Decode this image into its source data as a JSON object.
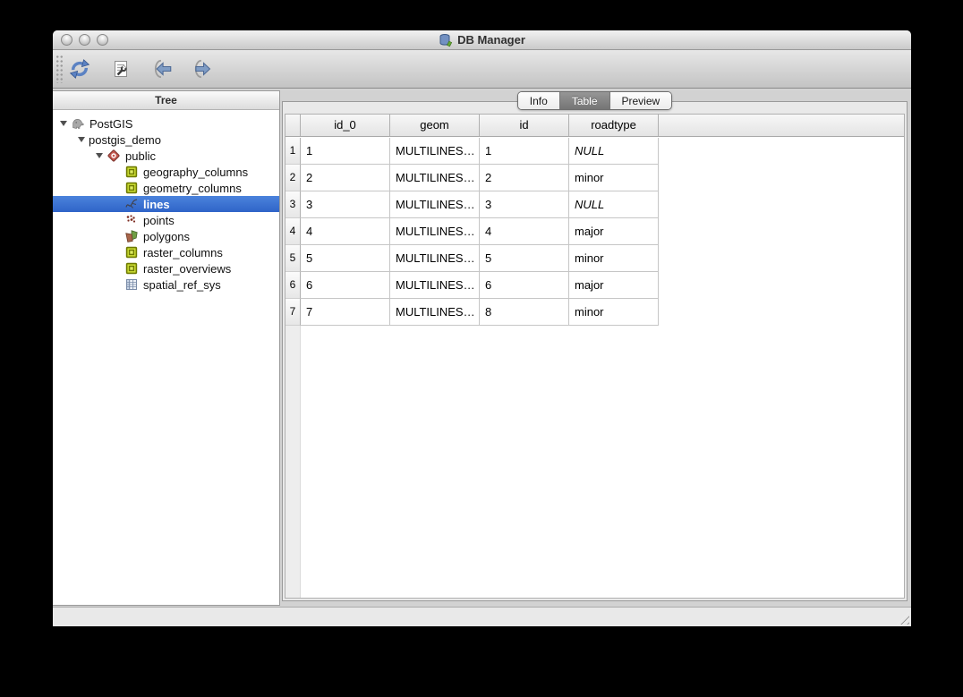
{
  "window": {
    "title": "DB Manager",
    "traffic_lights": [
      "close",
      "minimize",
      "zoom"
    ]
  },
  "toolbar": {
    "buttons": [
      {
        "name": "refresh",
        "icon": "refresh-icon"
      },
      {
        "name": "sql-window",
        "icon": "sql-window-icon"
      },
      {
        "name": "import-layer",
        "icon": "import-layer-icon"
      },
      {
        "name": "export-to-file",
        "icon": "export-to-file-icon"
      }
    ]
  },
  "sidebar": {
    "header": "Tree",
    "items": [
      {
        "label": "PostGIS",
        "level": 0,
        "icon": "postgis-icon",
        "expandable": true,
        "selected": false
      },
      {
        "label": "postgis_demo",
        "level": 1,
        "icon": null,
        "expandable": true,
        "selected": false
      },
      {
        "label": "public",
        "level": 2,
        "icon": "schema-icon",
        "expandable": true,
        "selected": false
      },
      {
        "label": "geography_columns",
        "level": 3,
        "icon": "attr-table-icon",
        "expandable": false,
        "selected": false
      },
      {
        "label": "geometry_columns",
        "level": 3,
        "icon": "attr-table-icon",
        "expandable": false,
        "selected": false
      },
      {
        "label": "lines",
        "level": 3,
        "icon": "line-layer-icon",
        "expandable": false,
        "selected": true
      },
      {
        "label": "points",
        "level": 3,
        "icon": "point-layer-icon",
        "expandable": false,
        "selected": false
      },
      {
        "label": "polygons",
        "level": 3,
        "icon": "polygon-layer-icon",
        "expandable": false,
        "selected": false
      },
      {
        "label": "raster_columns",
        "level": 3,
        "icon": "attr-table-icon",
        "expandable": false,
        "selected": false
      },
      {
        "label": "raster_overviews",
        "level": 3,
        "icon": "attr-table-icon",
        "expandable": false,
        "selected": false
      },
      {
        "label": "spatial_ref_sys",
        "level": 3,
        "icon": "table-icon",
        "expandable": false,
        "selected": false
      }
    ]
  },
  "tabs": [
    {
      "label": "Info",
      "active": false
    },
    {
      "label": "Table",
      "active": true
    },
    {
      "label": "Preview",
      "active": false
    }
  ],
  "table": {
    "columns": [
      "id_0",
      "geom",
      "id",
      "roadtype"
    ],
    "rows": [
      {
        "num": "1",
        "id_0": "1",
        "geom": "MULTILINES…",
        "id": "1",
        "roadtype": "NULL",
        "roadtype_null": true
      },
      {
        "num": "2",
        "id_0": "2",
        "geom": "MULTILINES…",
        "id": "2",
        "roadtype": "minor",
        "roadtype_null": false
      },
      {
        "num": "3",
        "id_0": "3",
        "geom": "MULTILINES…",
        "id": "3",
        "roadtype": "NULL",
        "roadtype_null": true
      },
      {
        "num": "4",
        "id_0": "4",
        "geom": "MULTILINES…",
        "id": "4",
        "roadtype": "major",
        "roadtype_null": false
      },
      {
        "num": "5",
        "id_0": "5",
        "geom": "MULTILINES…",
        "id": "5",
        "roadtype": "minor",
        "roadtype_null": false
      },
      {
        "num": "6",
        "id_0": "6",
        "geom": "MULTILINES…",
        "id": "6",
        "roadtype": "major",
        "roadtype_null": false
      },
      {
        "num": "7",
        "id_0": "7",
        "geom": "MULTILINES…",
        "id": "8",
        "roadtype": "minor",
        "roadtype_null": false
      }
    ]
  },
  "colors": {
    "selection_blue": "#3b74d6",
    "layer_green": "#cddf35",
    "schema_red": "#c4584f",
    "toolbar_arrow_blue": "#7f9cc4",
    "window_chrome": "#d4d4d4"
  }
}
